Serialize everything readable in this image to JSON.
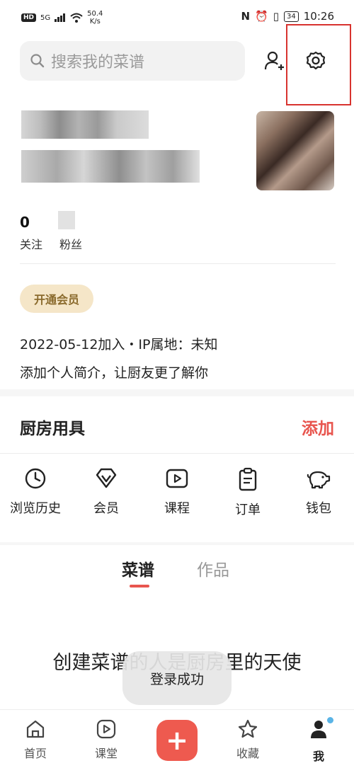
{
  "status_bar": {
    "hd": "HD",
    "signal": "5G",
    "speed": "50.4",
    "speed_unit": "K/s",
    "battery": "34",
    "time": "10:26"
  },
  "search": {
    "placeholder": "搜索我的菜谱"
  },
  "profile": {
    "following_count": "0",
    "following_label": "关注",
    "fans_label": "粉丝",
    "vip_button": "开通会员",
    "joined": "2022-05-12加入・IP属地：未知",
    "bio_prompt": "添加个人简介，让厨友更了解你"
  },
  "kitchen": {
    "title": "厨房用具",
    "add": "添加"
  },
  "shortcuts": [
    {
      "icon": "clock-icon",
      "label": "浏览历史"
    },
    {
      "icon": "diamond-icon",
      "label": "会员"
    },
    {
      "icon": "play-icon",
      "label": "课程"
    },
    {
      "icon": "clipboard-icon",
      "label": "订单"
    },
    {
      "icon": "piggy-bank-icon",
      "label": "钱包"
    }
  ],
  "content_tabs": {
    "active": "菜谱",
    "inactive": "作品"
  },
  "banner": "创建菜谱的人是厨房里的天使",
  "toast": "登录成功",
  "bottom_nav": {
    "home": "首页",
    "class": "课堂",
    "favorites": "收藏",
    "me": "我"
  },
  "colors": {
    "accent": "#e8554e",
    "vip_bg": "#f5e6c8",
    "vip_text": "#8a6a2c",
    "highlight_box": "#d8332f"
  }
}
